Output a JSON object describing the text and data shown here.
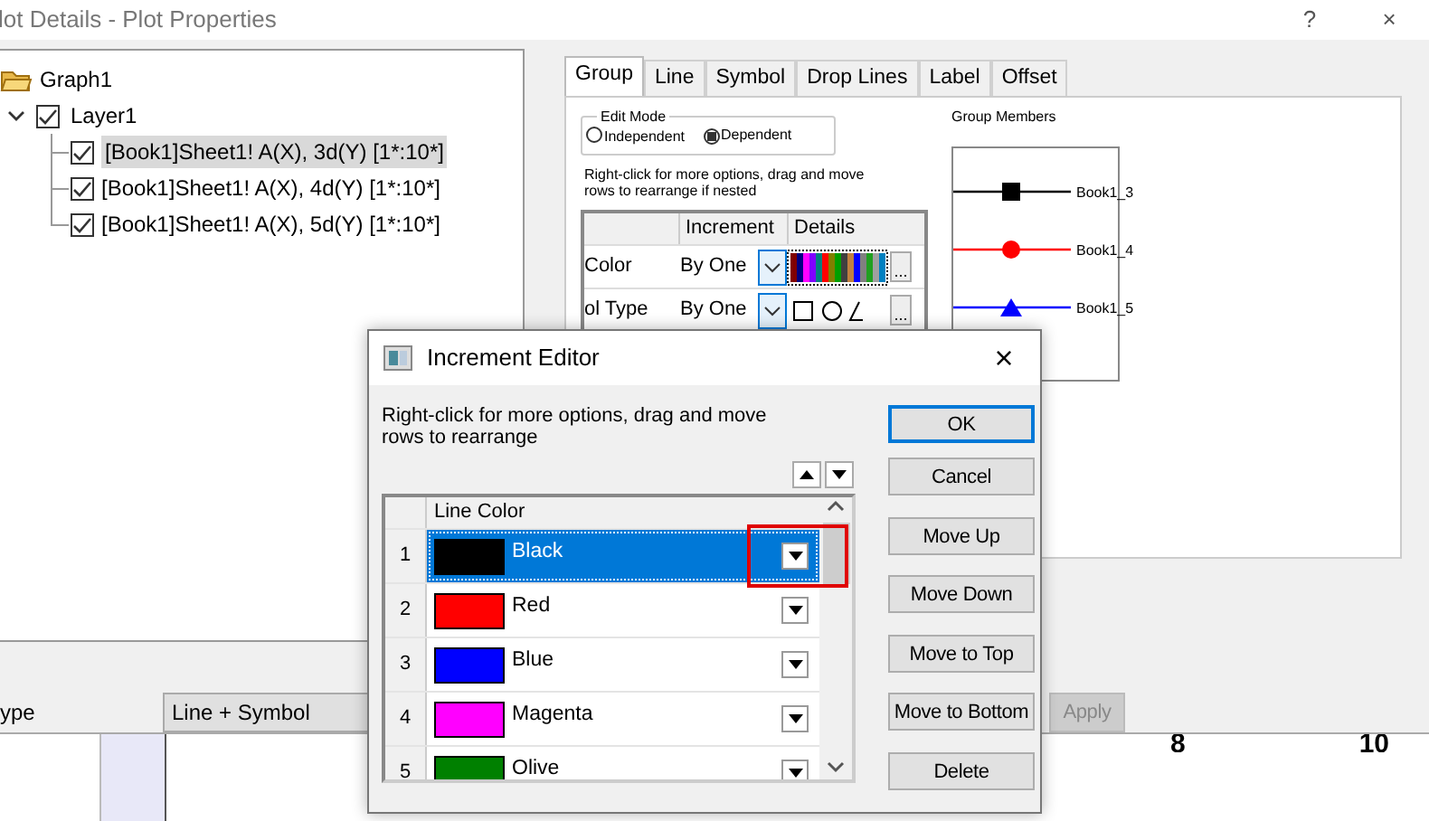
{
  "window": {
    "title": "lot Details - Plot Properties",
    "help": "?",
    "close": "×"
  },
  "tree": {
    "label": "Graph1",
    "children": [
      {
        "label": "Layer1",
        "checked": true,
        "expanded": true,
        "children": [
          {
            "label": "[Book1]Sheet1! A(X), 3d(Y) [1*:10*]",
            "checked": true,
            "selected": true
          },
          {
            "label": "[Book1]Sheet1! A(X), 4d(Y) [1*:10*]",
            "checked": true,
            "selected": false
          },
          {
            "label": "[Book1]Sheet1! A(X), 5d(Y) [1*:10*]",
            "checked": true,
            "selected": false
          }
        ]
      }
    ]
  },
  "tabs": [
    {
      "label": "Group",
      "selected": true
    },
    {
      "label": "Line",
      "selected": false
    },
    {
      "label": "Symbol",
      "selected": false
    },
    {
      "label": "Drop Lines",
      "selected": false
    },
    {
      "label": "Label",
      "selected": false
    },
    {
      "label": "Offset",
      "selected": false
    }
  ],
  "group_tab": {
    "edit_mode": {
      "title": "Edit Mode",
      "options": [
        {
          "label": "Independent",
          "selected": false
        },
        {
          "label": "Dependent",
          "selected": true
        }
      ]
    },
    "hint": "Right-click for more options, drag and move\nrows to  rearrange if nested",
    "table": {
      "columns": [
        "Increment",
        "Details"
      ],
      "rows": [
        {
          "name": "Color",
          "increment": "By One",
          "kind": "colors",
          "more": "..."
        },
        {
          "name": "ol Type",
          "increment": "By One",
          "kind": "symbols",
          "more": "..."
        }
      ]
    },
    "members": {
      "title": "Group Members",
      "items": [
        {
          "label": "Book1_3",
          "color": "#000000",
          "kind": "square"
        },
        {
          "label": "Book1_4",
          "color": "#ff0000",
          "kind": "circle"
        },
        {
          "label": "Book1_5",
          "color": "#0000ff",
          "kind": "triangle"
        }
      ]
    }
  },
  "bottom": {
    "type_label": "ype",
    "type_value": "Line + Symbol",
    "apply": {
      "label": "Apply",
      "disabled": true
    }
  },
  "graph": {
    "ticks": [
      "8",
      "10"
    ]
  },
  "dialog": {
    "title": "Increment Editor",
    "close": "×",
    "hint": "Right-click for more options, drag and move\nrows to  rearrange",
    "column": "Line Color",
    "rows": [
      {
        "index": "1",
        "name": "Black",
        "color": "#000000",
        "selected": true
      },
      {
        "index": "2",
        "name": "Red",
        "color": "#ff0000",
        "selected": false
      },
      {
        "index": "3",
        "name": "Blue",
        "color": "#0000ff",
        "selected": false
      },
      {
        "index": "4",
        "name": "Magenta",
        "color": "#ff00ff",
        "selected": false
      },
      {
        "index": "5",
        "name": "Olive",
        "color": "#008000",
        "selected": false
      }
    ],
    "buttons": [
      {
        "label": "OK",
        "default": true
      },
      {
        "label": "Cancel",
        "default": false
      },
      {
        "label": "Move Up",
        "default": false
      },
      {
        "label": "Move Down",
        "default": false
      },
      {
        "label": "Move to Top",
        "default": false
      },
      {
        "label": "Move to Bottom",
        "default": false
      },
      {
        "label": "Delete",
        "default": false
      }
    ]
  }
}
